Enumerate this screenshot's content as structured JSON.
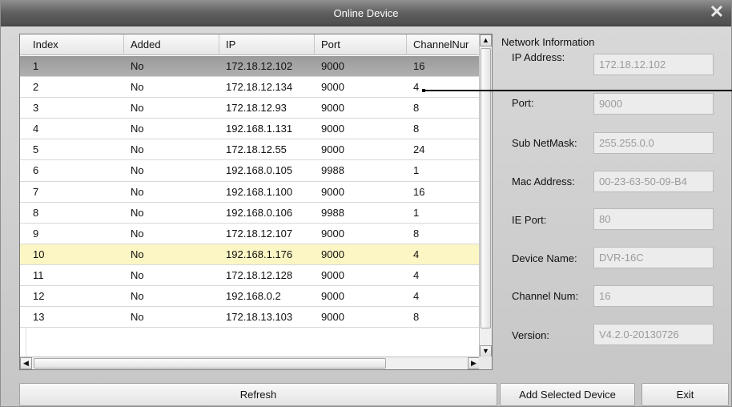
{
  "window": {
    "title": "Online Device",
    "close_glyph": "✕"
  },
  "table": {
    "columns": [
      "Index",
      "Added",
      "IP",
      "Port",
      "ChannelNur"
    ],
    "rows": [
      {
        "index": "1",
        "added": "No",
        "ip": "172.18.12.102",
        "port": "9000",
        "channels": "16",
        "state": "selected"
      },
      {
        "index": "2",
        "added": "No",
        "ip": "172.18.12.134",
        "port": "9000",
        "channels": "4",
        "state": ""
      },
      {
        "index": "3",
        "added": "No",
        "ip": "172.18.12.93",
        "port": "9000",
        "channels": "8",
        "state": ""
      },
      {
        "index": "4",
        "added": "No",
        "ip": "192.168.1.131",
        "port": "9000",
        "channels": "8",
        "state": ""
      },
      {
        "index": "5",
        "added": "No",
        "ip": "172.18.12.55",
        "port": "9000",
        "channels": "24",
        "state": ""
      },
      {
        "index": "6",
        "added": "No",
        "ip": "192.168.0.105",
        "port": "9988",
        "channels": "1",
        "state": ""
      },
      {
        "index": "7",
        "added": "No",
        "ip": "192.168.1.100",
        "port": "9000",
        "channels": "16",
        "state": ""
      },
      {
        "index": "8",
        "added": "No",
        "ip": "192.168.0.106",
        "port": "9988",
        "channels": "1",
        "state": ""
      },
      {
        "index": "9",
        "added": "No",
        "ip": "172.18.12.107",
        "port": "9000",
        "channels": "8",
        "state": ""
      },
      {
        "index": "10",
        "added": "No",
        "ip": "192.168.1.176",
        "port": "9000",
        "channels": "4",
        "state": "highlight"
      },
      {
        "index": "11",
        "added": "No",
        "ip": "172.18.12.128",
        "port": "9000",
        "channels": "4",
        "state": ""
      },
      {
        "index": "12",
        "added": "No",
        "ip": "192.168.0.2",
        "port": "9000",
        "channels": "4",
        "state": ""
      },
      {
        "index": "13",
        "added": "No",
        "ip": "172.18.13.103",
        "port": "9000",
        "channels": "8",
        "state": ""
      }
    ]
  },
  "network_info": {
    "heading": "Network Information",
    "fields": [
      {
        "label": "IP Address:",
        "value": "172.18.12.102"
      },
      {
        "label": "Port:",
        "value": "9000"
      },
      {
        "label": "Sub NetMask:",
        "value": "255.255.0.0"
      },
      {
        "label": "Mac Address:",
        "value": "00-23-63-50-09-B4"
      },
      {
        "label": "IE Port:",
        "value": "80"
      },
      {
        "label": "Device Name:",
        "value": "DVR-16C"
      },
      {
        "label": "Channel Num:",
        "value": "16"
      },
      {
        "label": "Version:",
        "value": "V4.2.0-20130726"
      }
    ]
  },
  "buttons": {
    "refresh": "Refresh",
    "add_selected": "Add Selected Device",
    "exit": "Exit"
  },
  "scroll": {
    "up": "▲",
    "down": "▼",
    "left": "◀",
    "right": "▶"
  }
}
